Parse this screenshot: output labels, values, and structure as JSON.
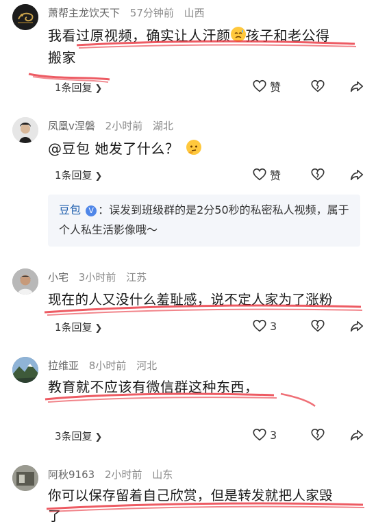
{
  "comments": [
    {
      "user": "萧帮主龙饮天下",
      "time": "57分钟前",
      "location": "山西",
      "text_line1": "我看过原视频，确实让人汗颜",
      "text_line1b": "孩子和老公得",
      "text_line2": "搬家",
      "replies": "1条回复",
      "like_label": "赞"
    },
    {
      "user": "凤凰v涅磐",
      "time": "2小时前",
      "location": "湖北",
      "text": "@豆包 她发了什么？",
      "replies": "1条回复",
      "like_label": "赞",
      "quote_name": "豆包",
      "quote_badge": "V",
      "quote_text": "：误发到班级群的是2分50秒的私密私人视频，属于个人私生活影像哦～"
    },
    {
      "user": "小宅",
      "time": "3小时前",
      "location": "江苏",
      "text": "现在的人又没什么羞耻感，说不定人家为了涨粉",
      "replies": "1条回复",
      "like_count": "3"
    },
    {
      "user": "拉维亚",
      "time": "8小时前",
      "location": "河北",
      "text": "教育就不应该有微信群这种东西，",
      "replies": "3条回复",
      "like_count": "3"
    },
    {
      "user": "阿秋9163",
      "time": "2小时前",
      "location": "山东",
      "text_line1": "你可以保存留着自己欣赏，但是转发就把人家毁",
      "text_line2": "了"
    }
  ],
  "icons": {
    "like": "heart-outline-icon",
    "dislike": "broken-heart-icon",
    "share": "share-arrow-icon",
    "chevron": "chevron-right-icon"
  },
  "colors": {
    "underline": "#e8323c",
    "meta": "#8a8a8a",
    "quote_bg": "#f4f6fa",
    "quote_name": "#1f5fae"
  }
}
